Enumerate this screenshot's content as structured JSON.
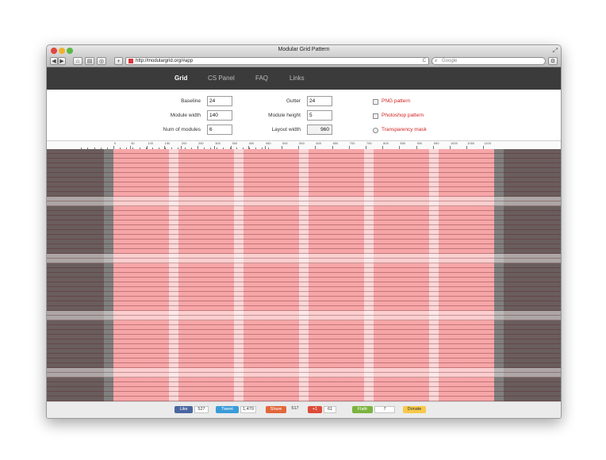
{
  "window": {
    "title": "Modular Grid Pattern"
  },
  "toolbar": {
    "back": "◀",
    "forward": "▶",
    "new_tab": "+",
    "url": "http://modulargrid.org/#app",
    "reload": "C",
    "search_placeholder": "Google"
  },
  "nav": {
    "items": [
      "Grid",
      "CS Panel",
      "FAQ",
      "Links"
    ],
    "active": "Grid"
  },
  "settings": {
    "baseline": {
      "label": "Baseline",
      "value": "24"
    },
    "module_width": {
      "label": "Module width",
      "value": "140"
    },
    "num_modules": {
      "label": "Num of modules",
      "value": "6"
    },
    "gutter": {
      "label": "Gutter",
      "value": "24"
    },
    "module_height": {
      "label": "Module height",
      "value": "5"
    },
    "layout_width": {
      "label": "Layout width",
      "value": "960"
    }
  },
  "downloads": {
    "png": "PNG pattern",
    "psd": "Photoshop pattern",
    "mask": "Transparency mask"
  },
  "ruler": {
    "labels": [
      "0",
      "50",
      "100",
      "150",
      "200",
      "250",
      "300",
      "350",
      "400",
      "450",
      "500",
      "550",
      "600",
      "650",
      "700",
      "750",
      "800",
      "850",
      "900",
      "950",
      "1000",
      "1050",
      "1100"
    ]
  },
  "social": {
    "like_label": "Like",
    "like_count": "527",
    "tweet_label": "Tweet",
    "tweet_count": "1,470",
    "share_label": "Share",
    "share_count": "517",
    "gplus_label": "+1",
    "gplus_count": "61",
    "flattr_label": "Flattr",
    "flattr_count": "7",
    "donate_label": "Donate"
  },
  "colors": {
    "nav_bg": "#3b3b3b",
    "module": "#f7a6a8",
    "gutter": "#fbd7d8",
    "margin": "#6a5d5d",
    "link_red": "#d11f1f"
  }
}
